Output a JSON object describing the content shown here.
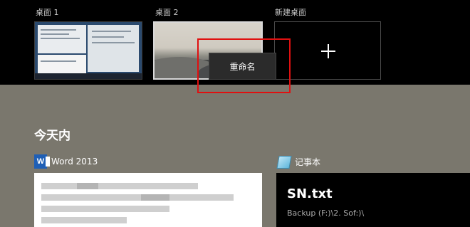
{
  "desktops": [
    {
      "label": "桌面 1"
    },
    {
      "label": "桌面 2"
    },
    {
      "label": "新建桌面"
    }
  ],
  "context_menu": {
    "rename": "重命名"
  },
  "highlight_color": "#e01010",
  "section": {
    "title": "今天内"
  },
  "apps": [
    {
      "name": "Word 2013",
      "icon": "word-icon",
      "icon_text": "W"
    },
    {
      "name": "记事本",
      "icon": "notepad-icon"
    }
  ],
  "notepad_preview": {
    "title": "SN.txt",
    "path": "Backup (F:)\\2. Sof:)\\"
  }
}
